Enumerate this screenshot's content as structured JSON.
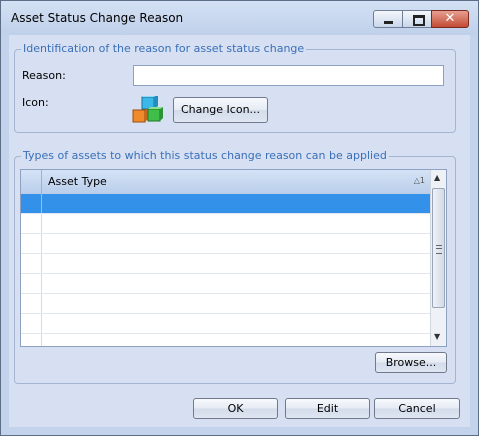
{
  "window": {
    "title": "Asset Status Change Reason",
    "controls": {
      "minimize_icon": "minimize-icon",
      "maximize_icon": "maximize-icon",
      "close_icon": "close-icon",
      "close_glyph": "✕"
    }
  },
  "identification_group": {
    "caption": "Identification of the reason for asset status change",
    "reason_label": "Reason:",
    "reason_value": "",
    "icon_label": "Icon:",
    "icon_name": "colored-cubes-icon",
    "change_icon_button": "Change Icon..."
  },
  "asset_types_group": {
    "caption": "Types of assets to which this status change reason can be applied",
    "grid": {
      "columns": [
        "Asset Type"
      ],
      "sort_indicator": "△1",
      "rows": [
        "",
        "",
        "",
        "",
        "",
        "",
        "",
        ""
      ],
      "selected_row": 0
    },
    "browse_button": "Browse..."
  },
  "buttons": {
    "ok": "OK",
    "edit": "Edit",
    "cancel": "Cancel"
  },
  "colors": {
    "accent": "#3391ea",
    "caption": "#3a6fb7",
    "background": "#d6e0f2"
  }
}
